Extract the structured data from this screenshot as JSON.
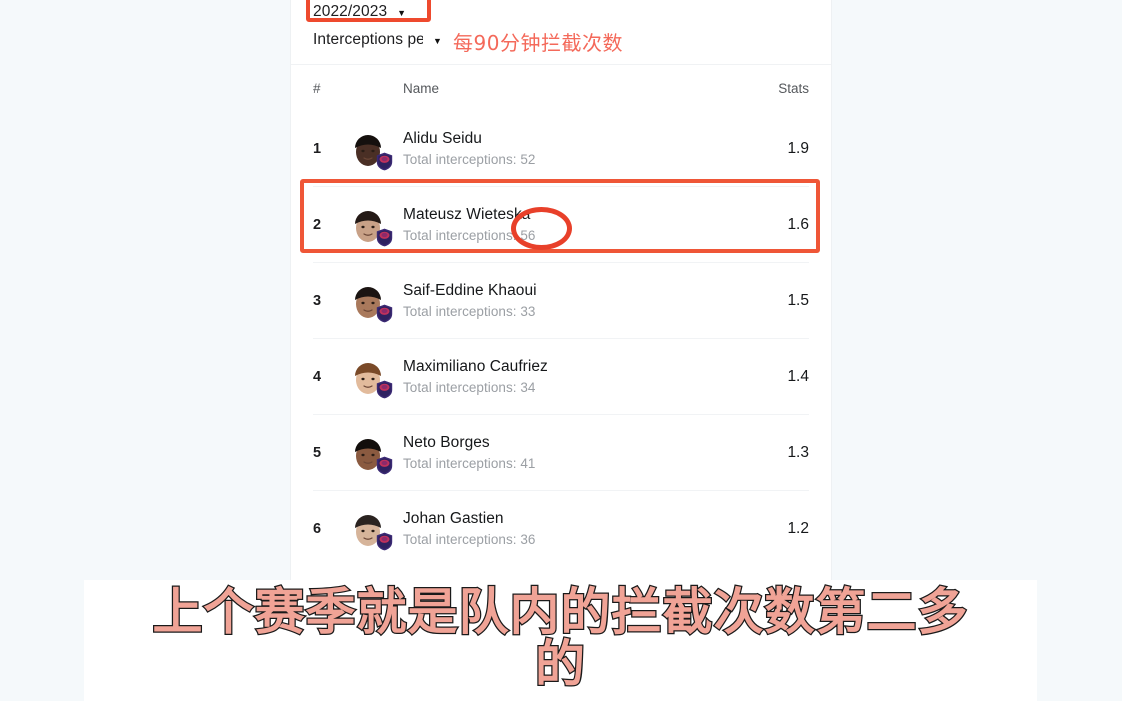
{
  "filters": {
    "season": {
      "value": "2022/2023",
      "caret": "chevron-down-icon"
    },
    "metric": {
      "value": "Interceptions pe",
      "caret": "chevron-down-icon"
    }
  },
  "annotations": {
    "metric_note_zh": "每90分钟拦截次数",
    "season_box_color": "#ee4a2e",
    "row_box_color": "#ef5637",
    "circle_color": "#e8402a"
  },
  "table": {
    "headers": {
      "rank": "#",
      "name": "Name",
      "stat": "Stats"
    },
    "rows": [
      {
        "rank": "1",
        "name": "Alidu Seidu",
        "sub": "Total interceptions: 52",
        "stat": "1.9"
      },
      {
        "rank": "2",
        "name": "Mateusz Wieteska",
        "sub": "Total interceptions: 56",
        "stat": "1.6"
      },
      {
        "rank": "3",
        "name": "Saif-Eddine Khaoui",
        "sub": "Total interceptions: 33",
        "stat": "1.5"
      },
      {
        "rank": "4",
        "name": "Maximiliano Caufriez",
        "sub": "Total interceptions: 34",
        "stat": "1.4"
      },
      {
        "rank": "5",
        "name": "Neto Borges",
        "sub": "Total interceptions: 41",
        "stat": "1.3"
      },
      {
        "rank": "6",
        "name": "Johan Gastien",
        "sub": "Total interceptions: 36",
        "stat": "1.2"
      }
    ]
  },
  "subtitle": {
    "line1": "上个赛季就是队内的拦截次数第二多",
    "line2": "的"
  }
}
